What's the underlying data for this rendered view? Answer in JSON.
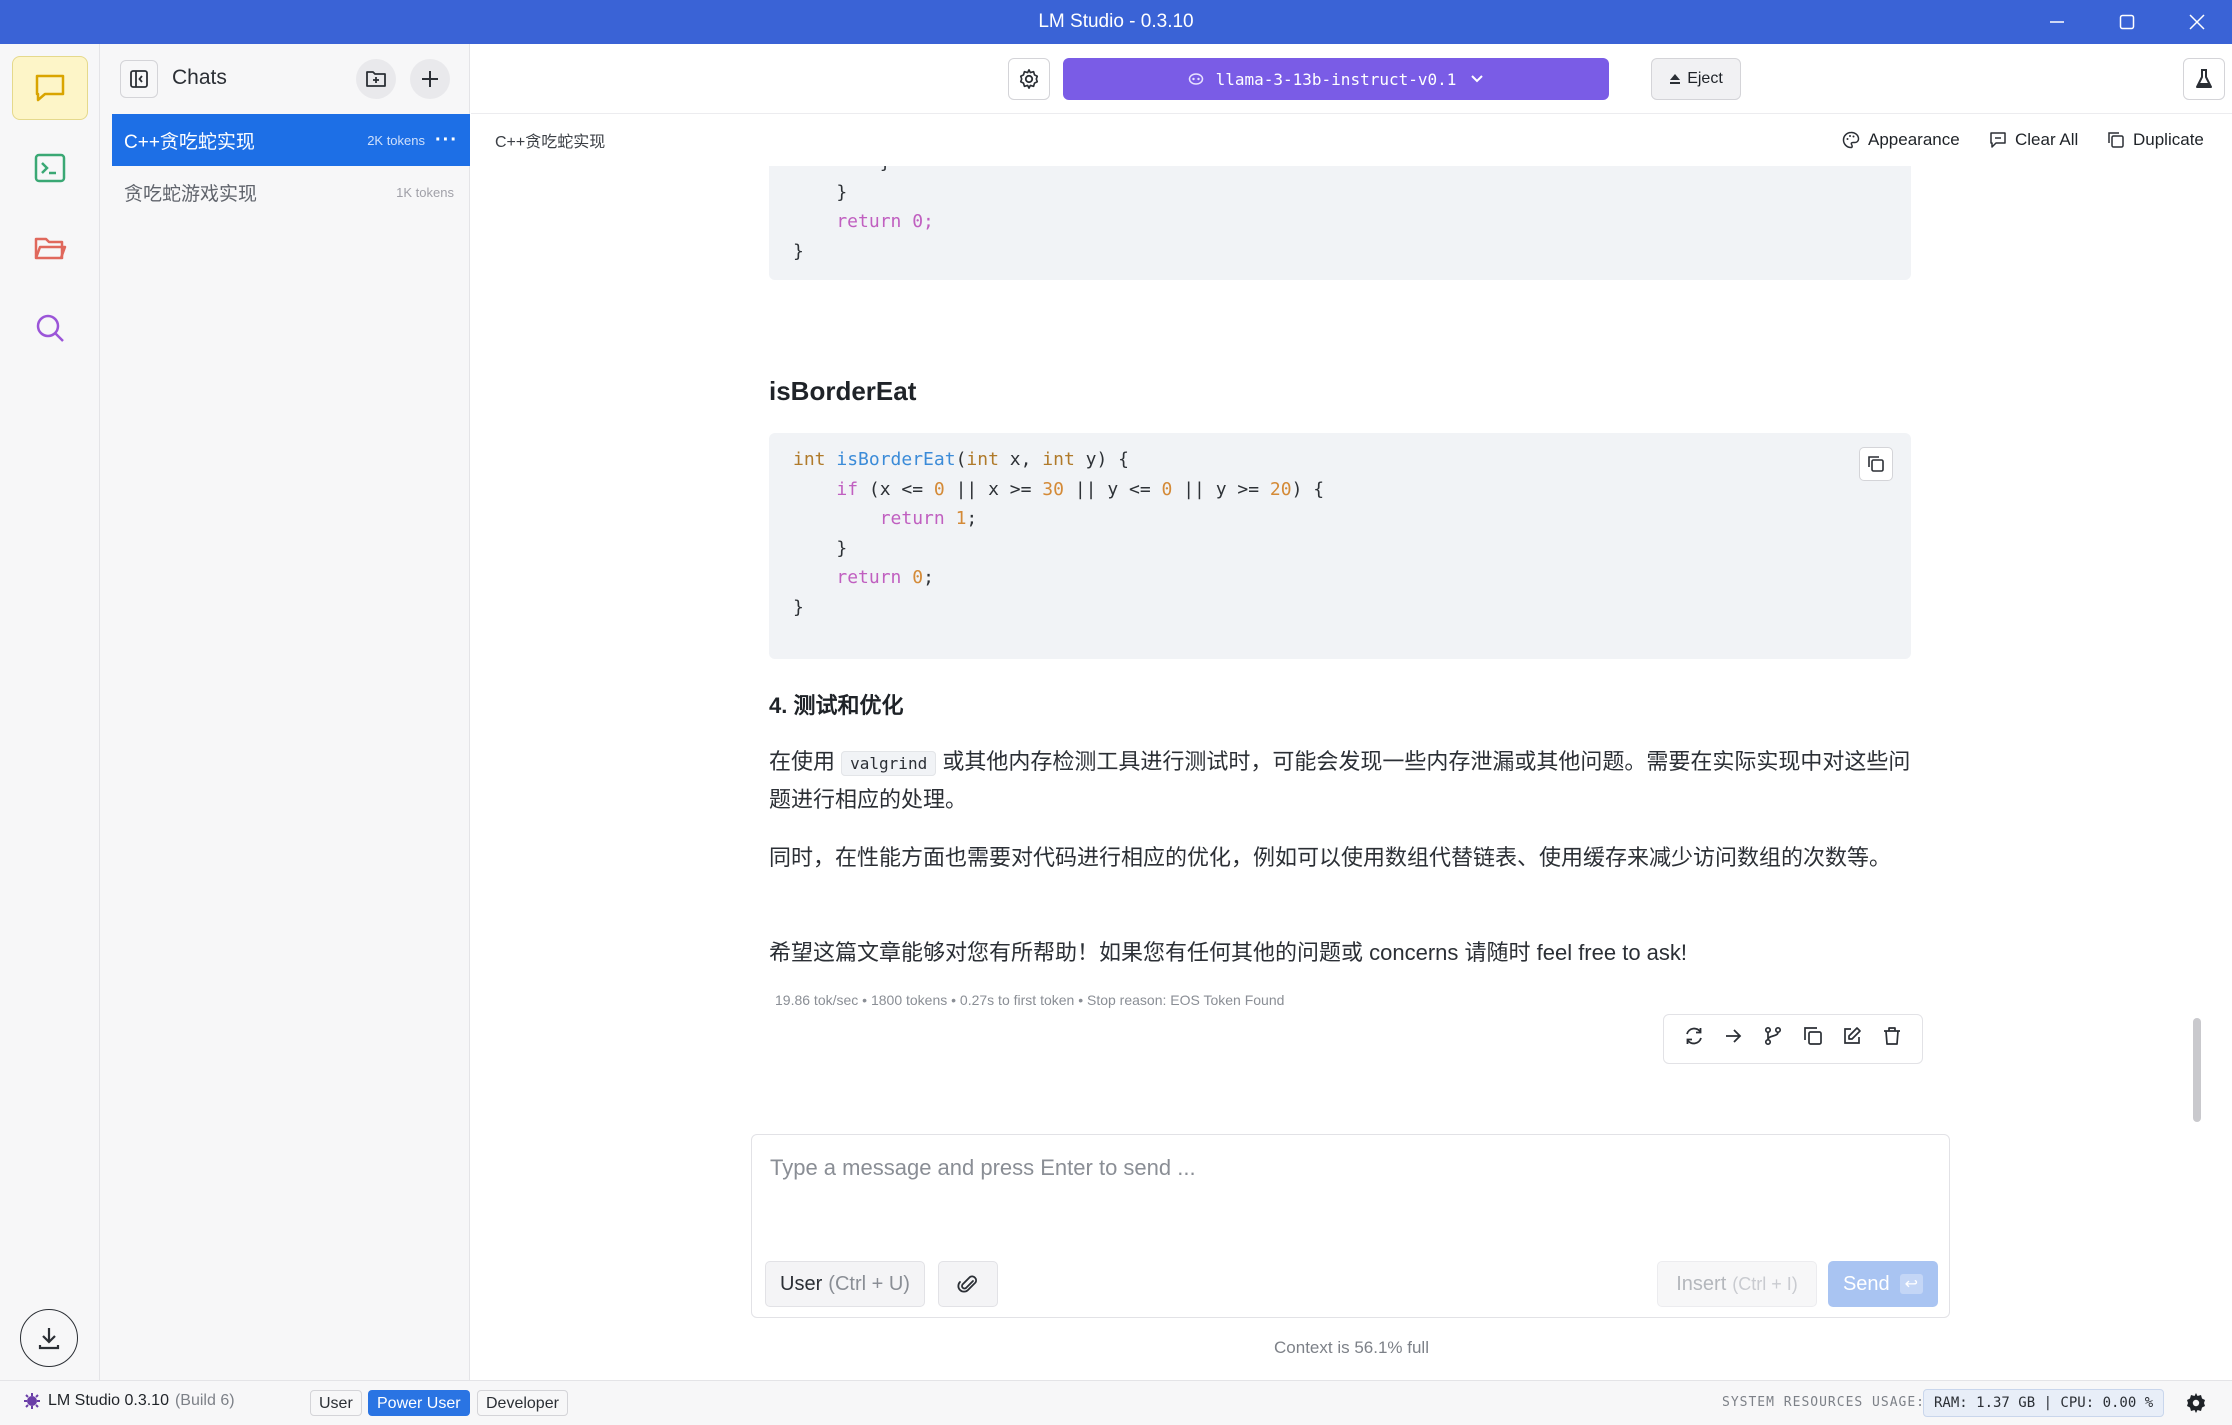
{
  "window": {
    "title": "LM Studio - 0.3.10"
  },
  "sidebar": {
    "title": "Chats",
    "chats": [
      {
        "name": "C++贪吃蛇实现",
        "tokens": "2K tokens",
        "more": "···"
      },
      {
        "name": "贪吃蛇游戏实现",
        "tokens": "1K tokens"
      }
    ]
  },
  "toolbar": {
    "model_name": "llama-3-13b-instruct-v0.1",
    "eject_label": "Eject"
  },
  "subheader": {
    "chat_title": "C++贪吃蛇实现",
    "appearance_label": "Appearance",
    "clear_all_label": "Clear All",
    "duplicate_label": "Duplicate"
  },
  "message": {
    "heading_border": "isBorderEat",
    "heading_section4": "4. 测试和优化",
    "para1_before": "在使用",
    "para1_code": "valgrind",
    "para1_after": "或其他内存检测工具进行测试时，可能会发现一些内存泄漏或其他问题。需要在实际实现中对这些问题进行相应的处理。",
    "para2": "同时，在性能方面也需要对代码进行相应的优化，例如可以使用数组代替链表、使用缓存来减少访问数组的次数等。",
    "para3": "希望这篇文章能够对您有所帮助！如果您有任何其他的问题或 concerns 请随时 feel free to ask!",
    "stats": "19.86 tok/sec • 1800 tokens • 0.27s to first token • Stop reason: EOS Token Found"
  },
  "code_top": {
    "lines": [
      "        }",
      "    }",
      "    return 0;",
      "}"
    ]
  },
  "code_border": {
    "lines": [
      "int isBorderEat(int x, int y) {",
      "    if (x <= 0 || x >= 30 || y <= 0 || y >= 20) {",
      "        return 1;",
      "    }",
      "    return 0;",
      "}"
    ]
  },
  "composer": {
    "placeholder": "Type a message and press Enter to send ...",
    "role_label": "User",
    "role_shortcut": "(Ctrl + U)",
    "insert_label": "Insert",
    "insert_shortcut": "(Ctrl + I)",
    "send_label": "Send",
    "send_key": "↩"
  },
  "context": "Context is 56.1% full",
  "statusbar": {
    "app_version": "LM Studio 0.3.10",
    "build": "(Build 6)",
    "modes": [
      "User",
      "Power User",
      "Developer"
    ],
    "active_mode": "Power User",
    "resources_label": "SYSTEM RESOURCES USAGE:",
    "resources_value": "RAM: 1.37 GB  |  CPU: 0.00 %"
  },
  "colors": {
    "titlebar": "#3a63d6",
    "model_button": "#7a5ce6",
    "active_chat": "#1d6fe6",
    "send_button": "#a9c4f2"
  }
}
